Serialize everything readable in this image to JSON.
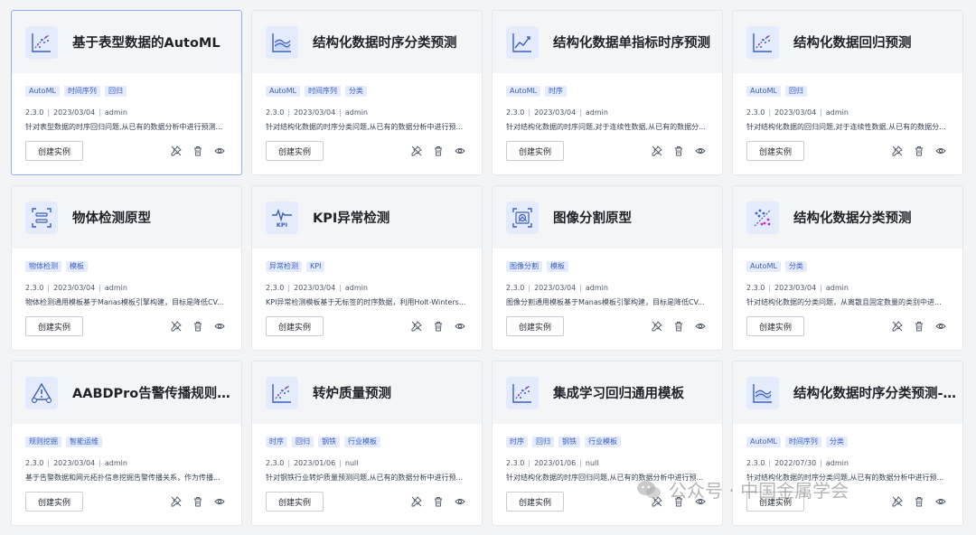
{
  "colors": {
    "accent": "#3b5fbf",
    "tag_bg": "#e3ebfd",
    "card_head_bg": "#f4f5f7"
  },
  "create_label": "创建实例",
  "cards": [
    {
      "icon": "scatter-plot-icon",
      "title": "基于表型数据的AutoML",
      "tags": [
        "AutoML",
        "时间序列",
        "回归"
      ],
      "version": "2.3.0",
      "date": "2023/03/04",
      "author": "admin",
      "description": "针对表型数据的时序回归问题,从已有的数据分析中进行预测..."
    },
    {
      "icon": "area-chart-icon",
      "title": "结构化数据时序分类预测",
      "tags": [
        "AutoML",
        "时间序列",
        "分类"
      ],
      "version": "2.3.0",
      "date": "2023/03/04",
      "author": "admin",
      "description": "针对结构化数据的时序分类问题,从已有的数据分析中进行预..."
    },
    {
      "icon": "line-trend-icon",
      "title": "结构化数据单指标时序预测",
      "tags": [
        "AutoML",
        "时序"
      ],
      "version": "2.3.0",
      "date": "2023/03/04",
      "author": "admin",
      "description": "针对结构化数据的时序问题,对于连续性数据,从已有的数据分..."
    },
    {
      "icon": "scatter-plot-icon",
      "title": "结构化数据回归预测",
      "tags": [
        "AutoML",
        "回归"
      ],
      "version": "2.3.0",
      "date": "2023/03/04",
      "author": "admin",
      "description": "针对结构化数据的回归问题,对于连续性数据,从已有的数据分..."
    },
    {
      "icon": "object-detect-icon",
      "title": "物体检测原型",
      "tags": [
        "物体检测",
        "模板"
      ],
      "version": "2.3.0",
      "date": "2023/03/04",
      "author": "admin",
      "description": "物体检测通用模板基于Manas模板引擎构建，目标是降低CV..."
    },
    {
      "icon": "kpi-icon",
      "title": "KPI异常检测",
      "tags": [
        "异常检测",
        "KPI"
      ],
      "version": "2.3.0",
      "date": "2023/03/04",
      "author": "admin",
      "description": "KPI异常检测模板基于无标签的时序数据，利用Holt-Winters..."
    },
    {
      "icon": "image-segment-icon",
      "title": "图像分割原型",
      "tags": [
        "图像分割",
        "模板"
      ],
      "version": "2.3.0",
      "date": "2023/03/04",
      "author": "admin",
      "description": "图像分割通用模板基于Manas模板引擎构建，目标是降低CV..."
    },
    {
      "icon": "classify-scatter-icon",
      "title": "结构化数据分类预测",
      "tags": [
        "AutoML",
        "分类"
      ],
      "version": "2.3.0",
      "date": "2023/03/04",
      "author": "admin",
      "description": "针对结构化数据的分类问题，从离散且固定数量的类别中进..."
    },
    {
      "icon": "alarm-rule-icon",
      "title": "AABDPro告警传播规则挖掘",
      "tags": [
        "规则挖掘",
        "智能运维"
      ],
      "version": "2.3.0",
      "date": "2023/03/04",
      "author": "admin",
      "description": "基于告警数据和网元拓扑信息挖掘告警传播关系，作为传播..."
    },
    {
      "icon": "scatter-plot-icon",
      "title": "转炉质量预测",
      "tags": [
        "时序",
        "回归",
        "钢铁",
        "行业模板"
      ],
      "version": "2.3.0",
      "date": "2023/01/06",
      "author": "null",
      "description": "针对钢铁行业转炉质量预测问题,从已有的数据分析中进行预..."
    },
    {
      "icon": "scatter-plot-icon",
      "title": "集成学习回归通用模板",
      "tags": [
        "时序",
        "回归",
        "钢铁",
        "行业模板"
      ],
      "version": "2.3.0",
      "date": "2023/01/06",
      "author": "null",
      "description": "针对结构化数据的时序回归问题,从已有的数据分析中进行预..."
    },
    {
      "icon": "area-chart-icon",
      "title": "结构化数据时序分类预测-n...",
      "tags": [
        "AutoML",
        "时间序列",
        "分类"
      ],
      "version": "2.3.0",
      "date": "2022/07/30",
      "author": "admin",
      "description": "针对结构化数据的时序分类问题,从已有的数据分析中进行预..."
    }
  ],
  "watermark": "公众号 · 中国金属学会"
}
